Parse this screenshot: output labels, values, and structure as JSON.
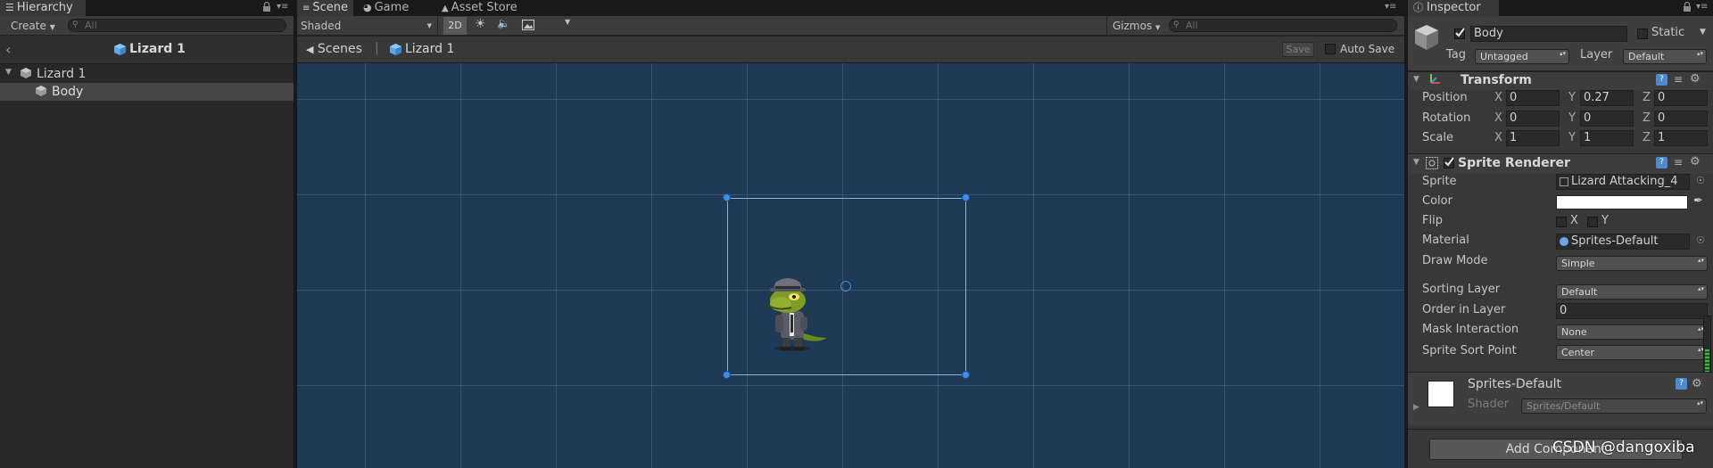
{
  "hierarchy": {
    "tab_label": "Hierarchy",
    "create_label": "Create",
    "search_placeholder": "All",
    "scene_name": "Lizard 1",
    "tree": [
      {
        "label": "Lizard 1",
        "depth": 0
      },
      {
        "label": "Body",
        "depth": 1,
        "selected": true
      }
    ]
  },
  "scene": {
    "tabs": [
      "Scene",
      "Game",
      "Asset Store"
    ],
    "active_tab": "Scene",
    "shading_mode": "Shaded",
    "mode_2d_label": "2D",
    "gizmos_label": "Gizmos",
    "search_placeholder": "All",
    "breadcrumb_root": "Scenes",
    "breadcrumb_item": "Lizard 1",
    "save_label": "Save",
    "auto_save_label": "Auto Save",
    "background_color": "#1f3a55"
  },
  "inspector": {
    "tab_label": "Inspector",
    "object_name": "Body",
    "static_label": "Static",
    "tag_label": "Tag",
    "tag_value": "Untagged",
    "layer_label": "Layer",
    "layer_value": "Default",
    "transform": {
      "title": "Transform",
      "rows": [
        {
          "label": "Position",
          "x": "0",
          "y": "0.27",
          "z": "0"
        },
        {
          "label": "Rotation",
          "x": "0",
          "y": "0",
          "z": "0"
        },
        {
          "label": "Scale",
          "x": "1",
          "y": "1",
          "z": "1"
        }
      ],
      "axis_x": "X",
      "axis_y": "Y",
      "axis_z": "Z"
    },
    "sprite_renderer": {
      "title": "Sprite Renderer",
      "sprite_label": "Sprite",
      "sprite_value": "Lizard Attacking_4",
      "color_label": "Color",
      "color_value": "#ffffff",
      "flip_label": "Flip",
      "flip_x": "X",
      "flip_y": "Y",
      "material_label": "Material",
      "material_value": "Sprites-Default",
      "draw_mode_label": "Draw Mode",
      "draw_mode_value": "Simple",
      "sorting_layer_label": "Sorting Layer",
      "sorting_layer_value": "Default",
      "order_label": "Order in Layer",
      "order_value": "0",
      "mask_label": "Mask Interaction",
      "mask_value": "None",
      "sort_point_label": "Sprite Sort Point",
      "sort_point_value": "Center"
    },
    "material_section": {
      "name": "Sprites-Default",
      "shader_label": "Shader",
      "shader_value": "Sprites/Default"
    },
    "add_component_label": "Add Component"
  },
  "watermark": "CSDN @dangoxiba"
}
